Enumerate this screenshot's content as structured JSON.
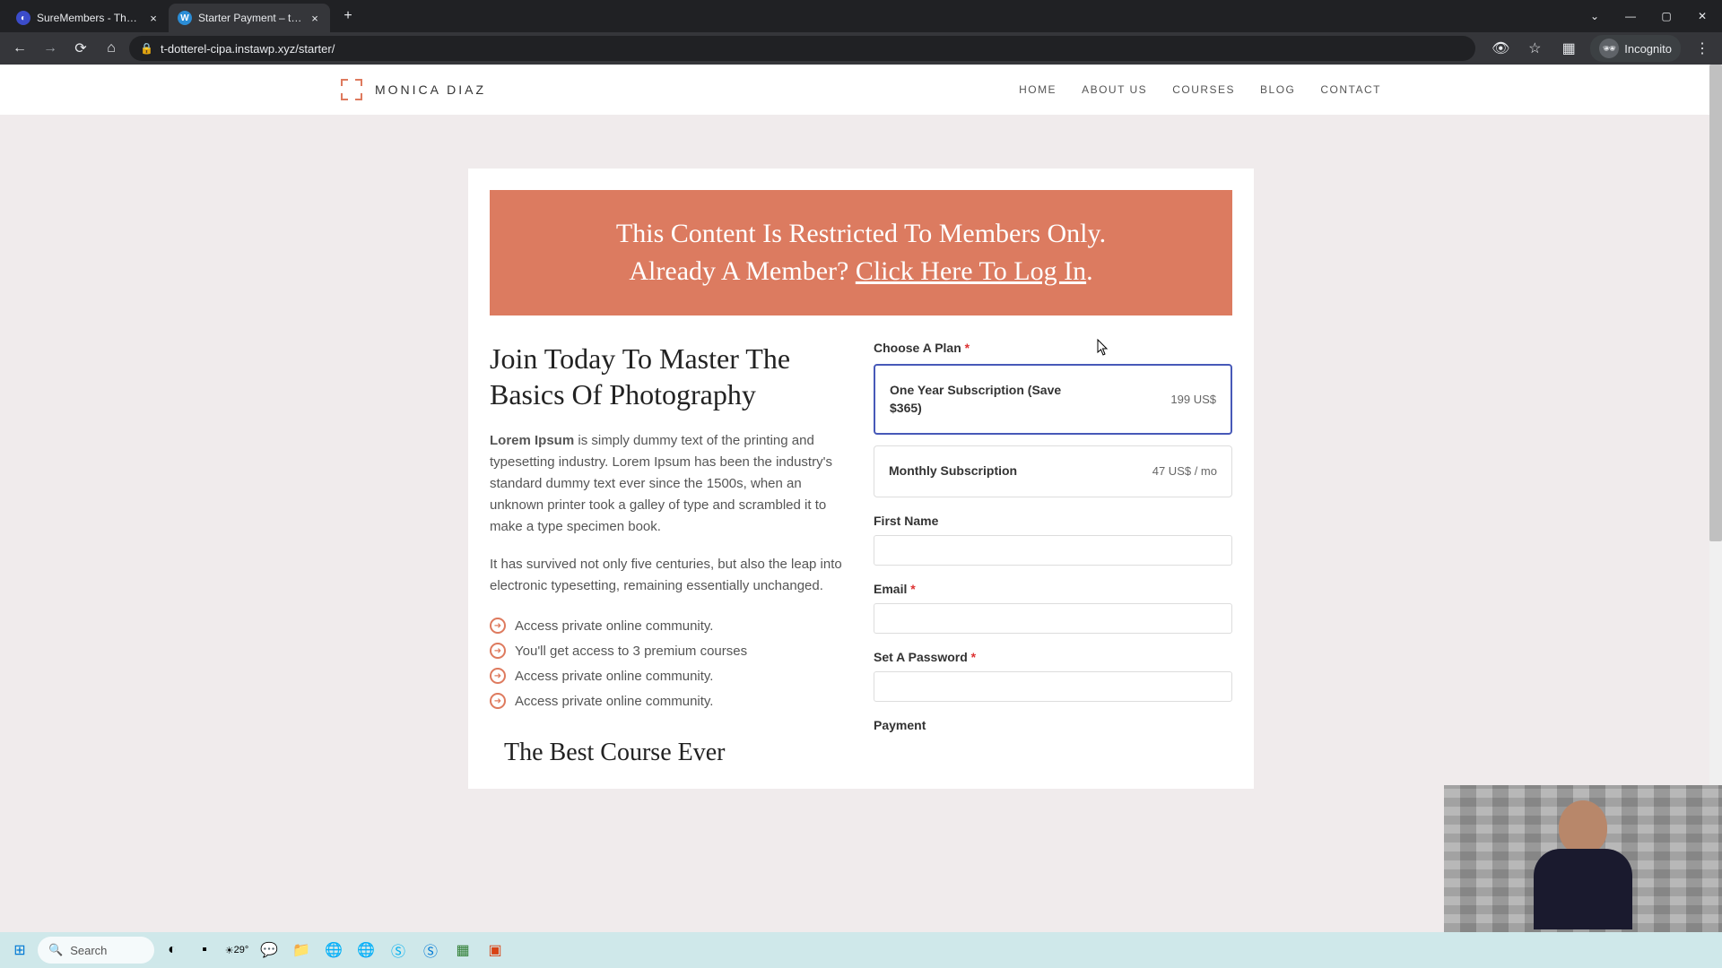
{
  "browser": {
    "tabs": [
      {
        "title": "SureMembers - The best membe",
        "favicon_bg": "#3b4cca",
        "favicon_char": "◐"
      },
      {
        "title": "Starter Payment – t-dotterel-cipa",
        "favicon_bg": "#2b8dd6",
        "favicon_char": "W"
      }
    ],
    "url": "t-dotterel-cipa.instawp.xyz/starter/",
    "incognito_label": "Incognito"
  },
  "site": {
    "brand": "MONICA DIAZ",
    "nav": [
      "HOME",
      "ABOUT US",
      "COURSES",
      "BLOG",
      "CONTACT"
    ]
  },
  "banner": {
    "line1": "This Content Is Restricted To Members Only.",
    "line2_prefix": "Already A Member? ",
    "line2_link": "Click Here To Log In",
    "line2_suffix": "."
  },
  "left": {
    "heading": "Join Today To Master The Basics Of Photography",
    "p1_strong": "Lorem Ipsum",
    "p1_rest": " is simply dummy text of the printing and typesetting industry. Lorem Ipsum has been the industry's standard dummy text ever since the 1500s, when an unknown printer took a galley of type and scrambled it to make a type specimen book.",
    "p2": "It has survived not only five centuries, but also the leap into electronic typesetting, remaining essentially unchanged.",
    "features": [
      "Access private online community.",
      "You'll get access to 3 premium courses",
      "Access private online community.",
      "Access private online community."
    ],
    "quote": "The Best Course Ever"
  },
  "form": {
    "plan_label": "Choose A Plan",
    "plans": [
      {
        "name": "One Year Subscription (Save $365)",
        "price": "199 US$"
      },
      {
        "name": "Monthly Subscription",
        "price": "47 US$ / mo"
      }
    ],
    "first_name_label": "First Name",
    "email_label": "Email",
    "password_label": "Set A Password",
    "payment_label": "Payment"
  },
  "taskbar": {
    "search_placeholder": "Search",
    "temp": "29°"
  }
}
